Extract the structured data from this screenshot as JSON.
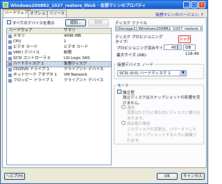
{
  "window": {
    "title": "Windows2008R2_1027_restore_thick - 仮想マシンのプロパティ",
    "help_link": "仮想マシンのバージョン: 7"
  },
  "tabs": [
    "ハードウェア",
    "オプション",
    "リソース"
  ],
  "hardware": {
    "show_all_devices_label": "すべてのデバイスを表示",
    "add_button": "追加...",
    "remove_button": "削除",
    "col_hardware": "ハードウェア",
    "col_summary": "サマリ",
    "rows": [
      {
        "name": "メモリ",
        "summary": "4096 MB"
      },
      {
        "name": "CPU",
        "summary": "1"
      },
      {
        "name": "ビデオ カード",
        "summary": "ビデオ カード"
      },
      {
        "name": "VMCI デバイス",
        "summary": "制限"
      },
      {
        "name": "SCSI コントローラ 0",
        "summary": "LSI Logic SAS"
      },
      {
        "name": "ハードディスク 1",
        "summary": "仮想ディスク"
      },
      {
        "name": "CD/DVD ドライブ 1",
        "summary": "クライアント デバイス"
      },
      {
        "name": "ネットワーク アダプタ 1",
        "summary": "VM Network"
      },
      {
        "name": "フロッピー ドライブ 1",
        "summary": "クライアント デバイス"
      }
    ],
    "selected_index": 5
  },
  "disk_file": {
    "label": "ディスク ファイル",
    "path": "[Storage1] Windows2008R2_1027_restore_thick/Windows2"
  },
  "provisioning": {
    "label": "ディスク プロビジョニング",
    "type_label": "タイプ:",
    "type_value": "シック",
    "size_label": "プロビジョニング済みサイズ:",
    "size_value": "40",
    "size_unit": "GB",
    "max_label": "最大サイズ (GB):",
    "max_value": "118.49"
  },
  "virtual_device_node": {
    "label": "仮想デバイス ノード",
    "value": "SCSI (0:0) ハードディスク 1"
  },
  "mode": {
    "label": "モード",
    "independent_label": "独立型",
    "independent_desc": "独立ディスクはスナップショットの影響を受けません。",
    "persistent_label": "通常",
    "persistent_desc": "変更はただちに恒久的にディスクに書き込まれます。",
    "nonpersistent_label": "読み取り専用",
    "nonpersistent_desc": "このディスクの変更は、パワーオフしたり、スナップショットするときに破棄されます。"
  },
  "buttons": {
    "help": "ヘルプ(H)",
    "ok": "OK",
    "cancel": "キャンセル"
  },
  "colors": {
    "title_bar": "#1254c9",
    "selection": "#cdd9ef",
    "annotation": "#e5221b"
  }
}
